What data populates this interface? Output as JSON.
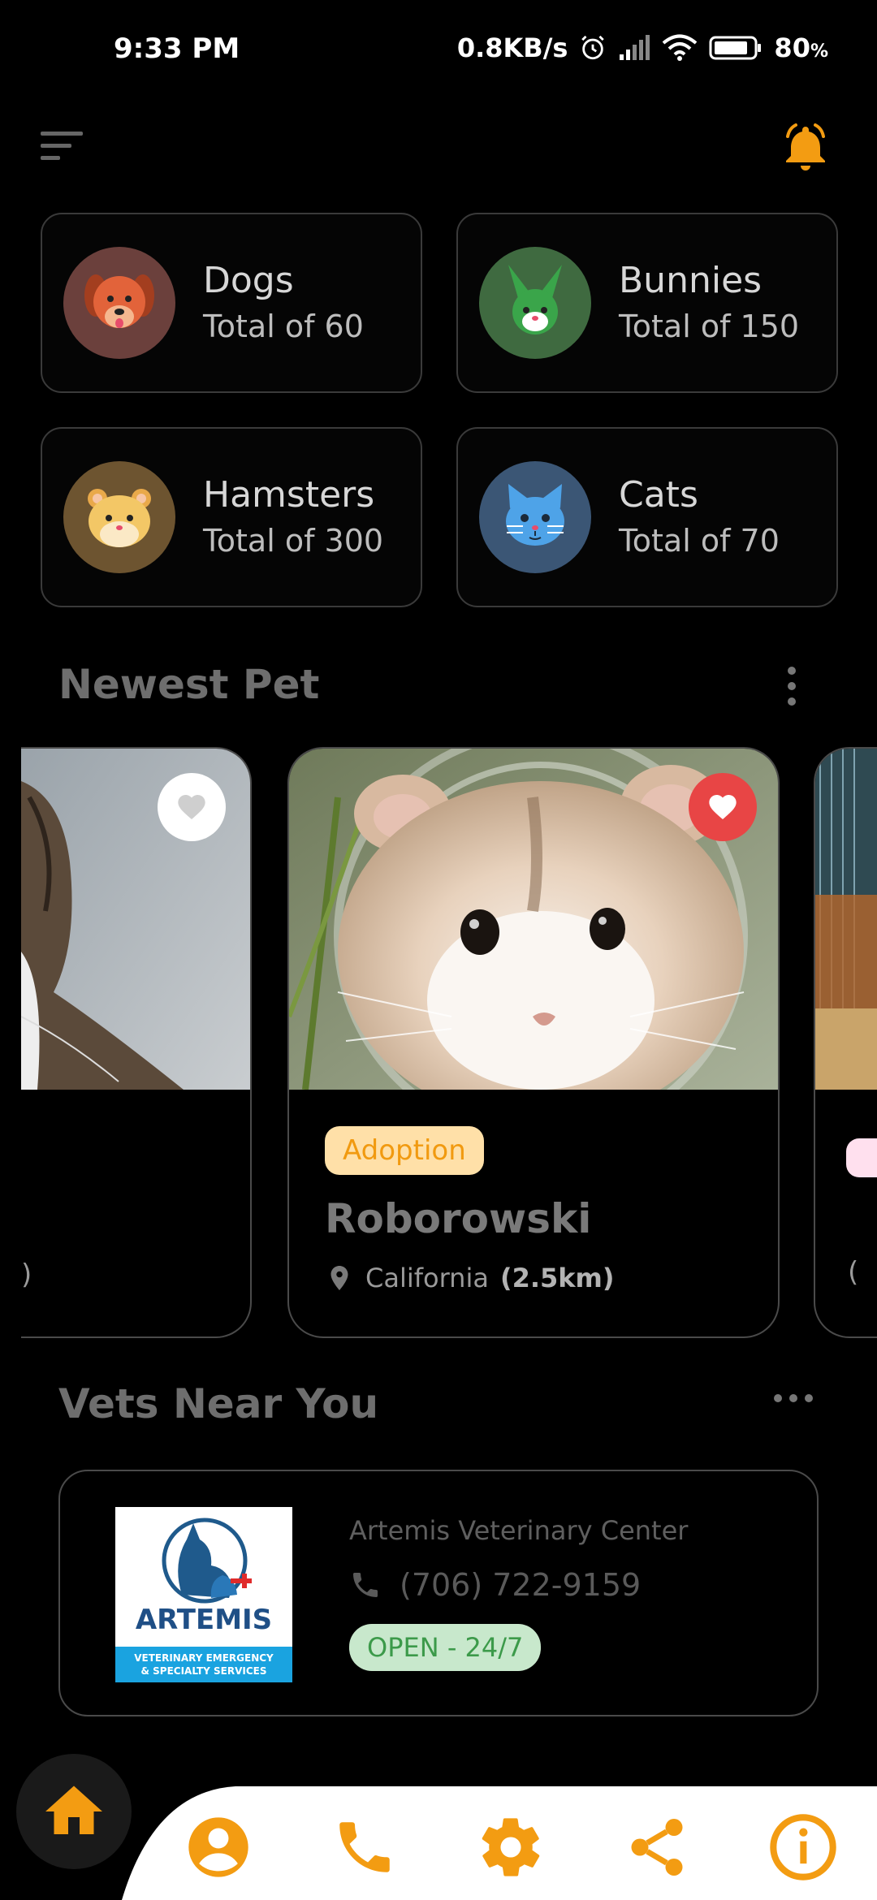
{
  "status_bar": {
    "time": "9:33 PM",
    "speed": "0.8KB/s",
    "battery": "80",
    "battery_unit": "%"
  },
  "categories": [
    {
      "name": "Dogs",
      "total": "Total of 60",
      "icon": "dog-icon",
      "color": "#6b403c"
    },
    {
      "name": "Bunnies",
      "total": "Total of 150",
      "icon": "bunny-icon",
      "color": "#3f6a40"
    },
    {
      "name": "Hamsters",
      "total": "Total of 300",
      "icon": "hamster-icon",
      "color": "#6d5430"
    },
    {
      "name": "Cats",
      "total": "Total of 70",
      "icon": "cat-icon",
      "color": "#3b5675"
    }
  ],
  "newest_pet": {
    "title": "Newest Pet",
    "left_card": {
      "partial_text": ")"
    },
    "main_card": {
      "tag": "Adoption",
      "name": "Roborowski",
      "location": "California",
      "distance": "(2.5km)"
    },
    "right_card": {
      "partial_text": "("
    }
  },
  "vets": {
    "title": "Vets Near You",
    "items": [
      {
        "name": "Artemis Veterinary Center",
        "phone": "(706) 722-9159",
        "status": "OPEN - 24/7",
        "logo_text": "ARTEMIS",
        "logo_sub1": "VETERINARY EMERGENCY",
        "logo_sub2": "& SPECIALTY SERVICES"
      }
    ]
  },
  "nav": {
    "items": [
      "home-icon",
      "profile-icon",
      "phone-icon",
      "settings-icon",
      "share-icon",
      "info-icon"
    ]
  },
  "colors": {
    "accent": "#f39c12",
    "favorite_active": "#e84545",
    "open_badge_bg": "#c8e8cc"
  }
}
